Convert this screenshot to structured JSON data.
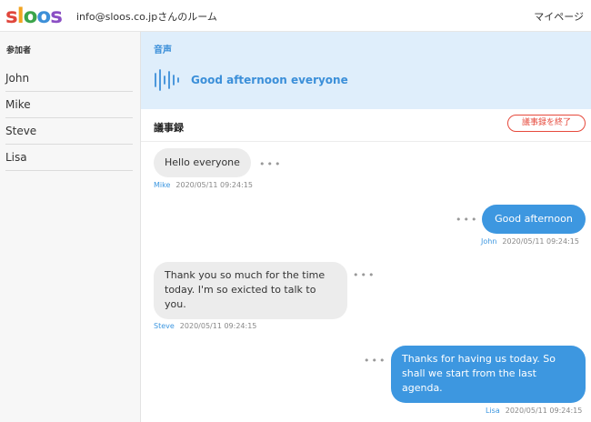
{
  "header": {
    "logo": [
      "s",
      "l",
      "o",
      "o",
      "s"
    ],
    "logo_colors": [
      "#e0463c",
      "#f2a421",
      "#3ba44a",
      "#3c8fd8",
      "#8b4fc4"
    ],
    "room_title": "info@sloos.co.jpさんのルーム",
    "mypage_label": "マイページ"
  },
  "sidebar": {
    "heading": "参加者",
    "participants": [
      "John",
      "Mike",
      "Steve",
      "Lisa"
    ]
  },
  "voice": {
    "label": "音声",
    "icon": "sound-wave-icon",
    "text": "Good afternoon everyone"
  },
  "minutes": {
    "title": "議事録",
    "end_button": "議事録を終了"
  },
  "messages": [
    {
      "speaker": "Mike",
      "timestamp": "2020/05/11 09:24:15",
      "lines": [
        "Hello everyone"
      ],
      "side": "left"
    },
    {
      "speaker": "John",
      "timestamp": "2020/05/11 09:24:15",
      "lines": [
        "Good afternoon"
      ],
      "side": "right"
    },
    {
      "speaker": "Steve",
      "timestamp": "2020/05/11 09:24:15",
      "lines": [
        "Thank you so much for the time",
        "today. I'm so exicted to talk to",
        "you."
      ],
      "side": "left"
    },
    {
      "speaker": "Lisa",
      "timestamp": "2020/05/11 09:24:15",
      "lines": [
        "Thanks for having us today. So",
        "shall we start from the last",
        "agenda."
      ],
      "side": "right"
    }
  ],
  "more_icon": "•••",
  "colors": {
    "accent": "#3d97e0",
    "voice_bg": "#dfeefb",
    "end_button": "#e64a3c"
  }
}
